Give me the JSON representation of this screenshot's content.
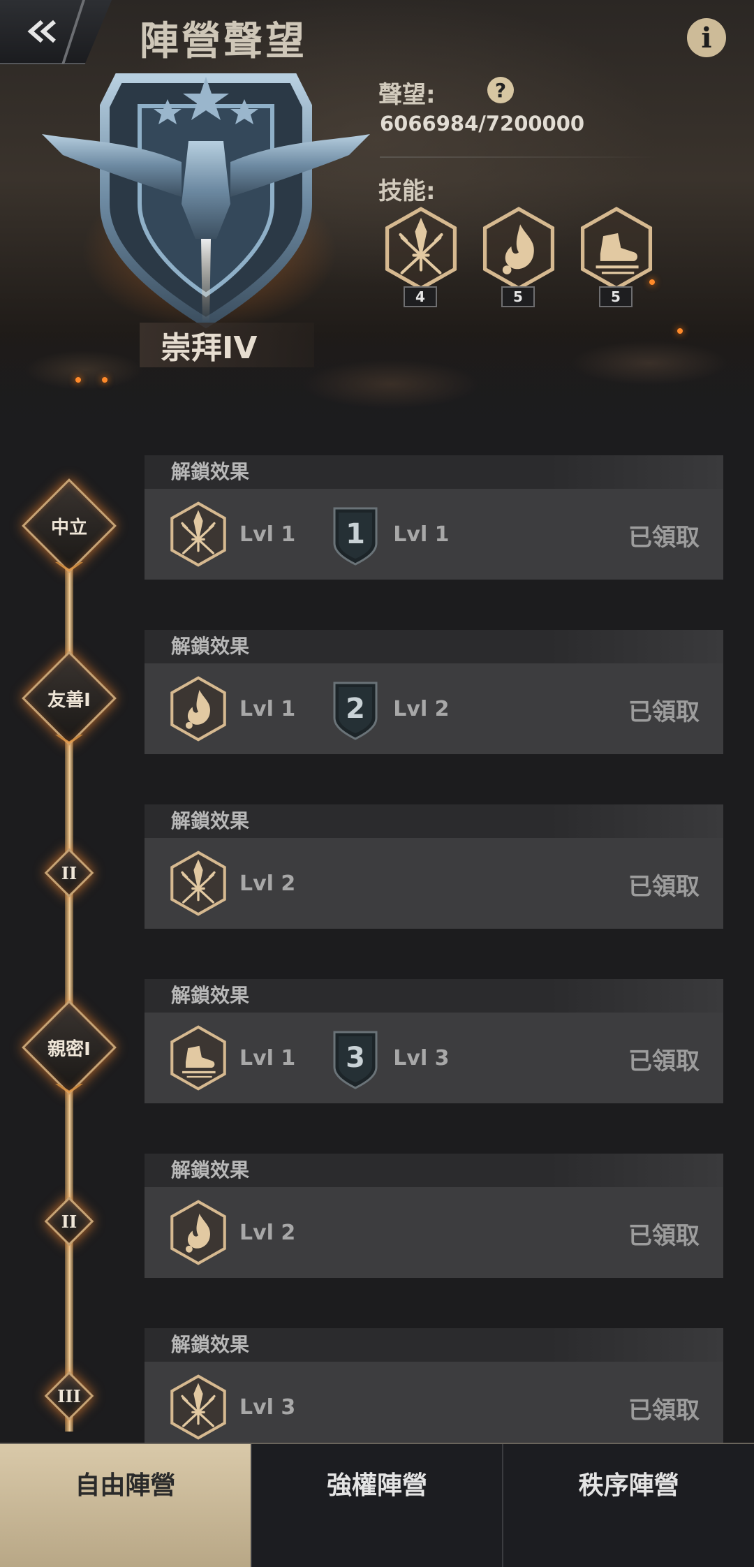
{
  "header": {
    "title": "陣營聲望",
    "rank": "崇拜IV",
    "prestige_label": "聲望:",
    "prestige_value": "6066984/7200000",
    "skills_label": "技能:",
    "skills": [
      {
        "icon": "weapons-icon",
        "level": "4"
      },
      {
        "icon": "fire-icon",
        "level": "5"
      },
      {
        "icon": "boot-icon",
        "level": "5"
      }
    ]
  },
  "timeline": {
    "nodes": [
      {
        "label": "中立"
      },
      {
        "label": "友善I"
      },
      {
        "label": "II"
      },
      {
        "label": "親密I"
      },
      {
        "label": "II"
      },
      {
        "label": "III"
      }
    ]
  },
  "rewards": [
    {
      "title": "解鎖效果",
      "skill_icon": "weapons-icon",
      "skill_level": "Lvl 1",
      "badge_number": "1",
      "badge_level": "Lvl 1",
      "status": "已領取"
    },
    {
      "title": "解鎖效果",
      "skill_icon": "fire-icon",
      "skill_level": "Lvl 1",
      "badge_number": "2",
      "badge_level": "Lvl 2",
      "status": "已領取"
    },
    {
      "title": "解鎖效果",
      "skill_icon": "weapons-icon",
      "skill_level": "Lvl 2",
      "status": "已領取"
    },
    {
      "title": "解鎖效果",
      "skill_icon": "boot-icon",
      "skill_level": "Lvl 1",
      "badge_number": "3",
      "badge_level": "Lvl 3",
      "status": "已領取"
    },
    {
      "title": "解鎖效果",
      "skill_icon": "fire-icon",
      "skill_level": "Lvl 2",
      "status": "已領取"
    },
    {
      "title": "解鎖效果",
      "skill_icon": "weapons-icon",
      "skill_level": "Lvl 3",
      "status": "已領取"
    }
  ],
  "tabs": [
    {
      "label": "自由陣營",
      "active": true
    },
    {
      "label": "強權陣營",
      "active": false
    },
    {
      "label": "秩序陣營",
      "active": false
    }
  ],
  "colors": {
    "accent_gold": "#c6a375",
    "active_tab": "#d9c9a9",
    "card_bg": "#3d3d3f"
  }
}
